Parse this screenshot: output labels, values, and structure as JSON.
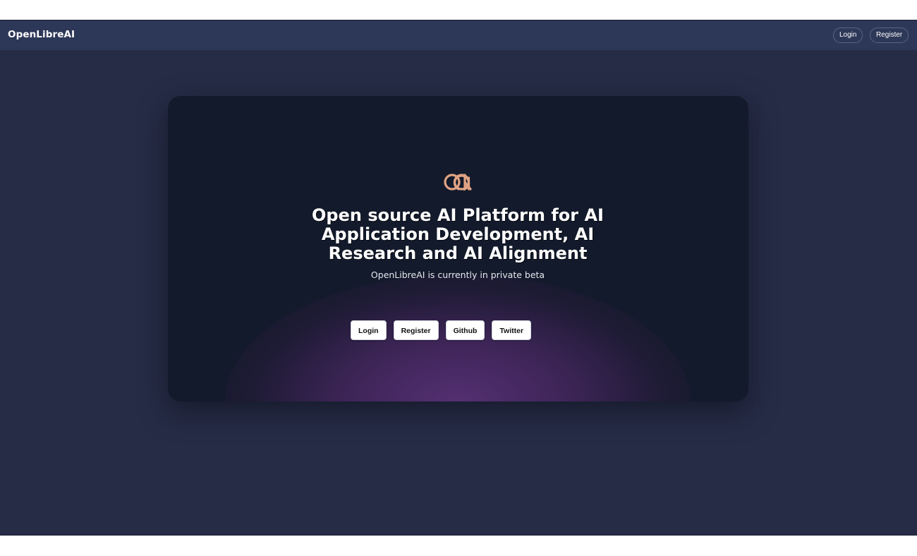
{
  "navbar": {
    "brand": "OpenLibreAI",
    "login_label": "Login",
    "register_label": "Register"
  },
  "hero": {
    "headline": "Open source AI Platform for AI Application Development, AI Research and AI Alignment",
    "subtitle": "OpenLibreAI is currently in private beta",
    "buttons": [
      {
        "label": "Login"
      },
      {
        "label": "Register"
      },
      {
        "label": "Github"
      },
      {
        "label": "Twitter"
      }
    ],
    "logo_icon": "openlibreai-logo-icon"
  },
  "colors": {
    "page_background": "#262c46",
    "navbar_background": "#2d3757",
    "card_background": "#131a2b",
    "glow_accent": "#583076",
    "logo_accent": "#e0a383"
  }
}
